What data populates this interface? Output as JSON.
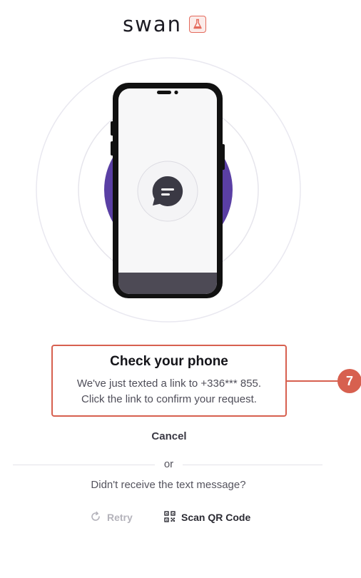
{
  "header": {
    "logo_text": "swan",
    "sandbox_icon": "flask-icon",
    "brand_color": "#5a3fa4"
  },
  "illustration": {
    "phone_icon": "smartphone-icon",
    "message_icon": "chat-bubble-icon"
  },
  "callout": {
    "title": "Check your phone",
    "line1": "We've just texted a link to +336***   855.",
    "line2": "Click the link to confirm your request.",
    "accent_color": "#d7604f"
  },
  "annotation": {
    "step_number": "7"
  },
  "actions": {
    "cancel_label": "Cancel",
    "or_label": "or",
    "didnt_receive": "Didn't receive the text message?",
    "retry_label": "Retry",
    "retry_icon": "refresh-icon",
    "qr_label": "Scan QR Code",
    "qr_icon": "qr-code-icon"
  }
}
